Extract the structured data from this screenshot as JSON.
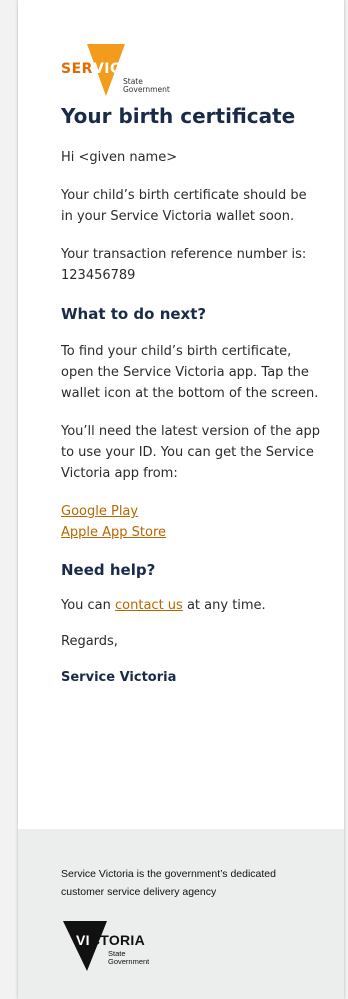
{
  "logo": {
    "service_pre": "SER",
    "service_post": "VICE",
    "state_line1": "State",
    "state_line2": "Government"
  },
  "email": {
    "title": "Your birth certificate",
    "greeting": "Hi <given name>",
    "para1": "Your child’s birth certificate should be in your Service Victoria wallet soon.",
    "para2": "Your transaction reference number is: 123456789",
    "next_heading": "What to do next?",
    "para3": "To find your child’s birth certificate, open the Service Victoria app. Tap the wallet icon at the bottom of the screen.",
    "para4": "You’ll need the latest version of the app to use your ID. You can get the Service Victoria app from:",
    "link_google": "Google Play",
    "link_apple": "Apple App Store",
    "help_heading": "Need help?",
    "help_pre": "You can ",
    "help_link": "contact us",
    "help_post": " at any time.",
    "regards": "Regards,",
    "signature": "Service Victoria"
  },
  "footer": {
    "text": "Service Victoria is the government’s dedicated customer service delivery agency",
    "vic_pre": "VI",
    "vic_post": "CTORIA",
    "state_line1": "State",
    "state_line2": "Government"
  },
  "colors": {
    "brand_orange": "#f39b1c",
    "heading_navy": "#1a2b48",
    "link": "#b86700",
    "footer_bg": "#eceded"
  }
}
